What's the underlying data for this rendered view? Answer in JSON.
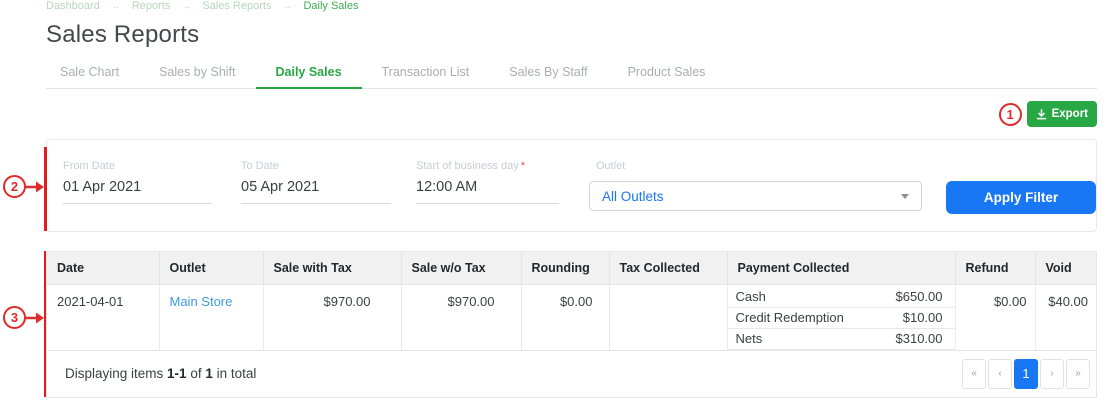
{
  "breadcrumb": {
    "separator": "→",
    "items": [
      {
        "label": "Dashboard"
      },
      {
        "label": "Reports"
      },
      {
        "label": "Sales Reports"
      },
      {
        "label": "Daily Sales"
      }
    ]
  },
  "page": {
    "title": "Sales Reports"
  },
  "tabs": [
    {
      "label": "Sale Chart"
    },
    {
      "label": "Sales by Shift"
    },
    {
      "label": "Daily Sales",
      "active": true
    },
    {
      "label": "Transaction List"
    },
    {
      "label": "Sales By Staff"
    },
    {
      "label": "Product Sales"
    }
  ],
  "toolbar": {
    "export_label": "Export"
  },
  "filter": {
    "from_date": {
      "label": "From Date",
      "value": "01 Apr 2021"
    },
    "to_date": {
      "label": "To Date",
      "value": "05 Apr 2021"
    },
    "start_of_day": {
      "label": "Start of business day",
      "required": "*",
      "value": "12:00 AM"
    },
    "outlet": {
      "label": "Outlet",
      "value": "All Outlets"
    },
    "apply_label": "Apply Filter"
  },
  "table": {
    "columns": [
      "Date",
      "Outlet",
      "Sale with Tax",
      "Sale w/o Tax",
      "Rounding",
      "Tax Collected",
      "Payment Collected",
      "Refund",
      "Void"
    ],
    "rows": [
      {
        "date": "2021-04-01",
        "outlet": "Main Store",
        "sale_with_tax": "$970.00",
        "sale_wo_tax": "$970.00",
        "rounding": "$0.00",
        "tax_collected": "",
        "payments": [
          {
            "name": "Cash",
            "amount": "$650.00"
          },
          {
            "name": "Credit Redemption",
            "amount": "$10.00"
          },
          {
            "name": "Nets",
            "amount": "$310.00"
          }
        ],
        "refund": "$0.00",
        "void": "$40.00"
      }
    ],
    "footer": {
      "summary_prefix": "Displaying items ",
      "range": "1-1",
      "of_text": " of ",
      "total": "1",
      "suffix": " in total"
    },
    "pagination": {
      "first": "«",
      "prev": "‹",
      "page1": "1",
      "next": "›",
      "last": "»",
      "active_page": "1"
    }
  },
  "annotations": {
    "one": "1",
    "two": "2",
    "three": "3"
  },
  "colors": {
    "accent_green": "#28a745",
    "accent_blue": "#1877f2",
    "link_blue": "#3c9bdc",
    "annotation_red": "#dd2b2b",
    "breadcrumb_green": "#3dae54"
  }
}
